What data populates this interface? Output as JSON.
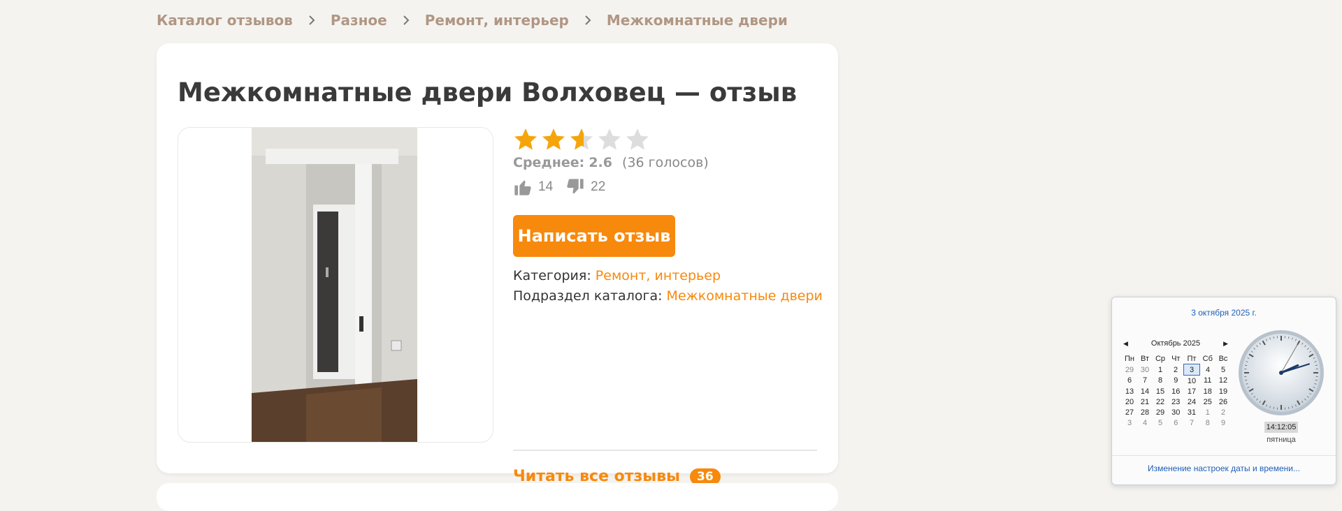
{
  "breadcrumb": [
    {
      "label": "Каталог отзывов"
    },
    {
      "label": "Разное"
    },
    {
      "label": "Ремонт, интерьер"
    },
    {
      "label": "Межкомнатные двери"
    }
  ],
  "product": {
    "title": "Межкомнатные двери Волховец — отзыв",
    "rating_value": 2.6,
    "rating_max": 5,
    "average_label": "Среднее:",
    "average_value": "2.6",
    "votes_text": "(36 голосов)",
    "likes": "14",
    "dislikes": "22",
    "write_button": "Написать отзыв",
    "category_label": "Категория:",
    "category_value": "Ремонт, интерьер",
    "subsection_label": "Подраздел каталога:",
    "subsection_value": "Межкомнатные двери",
    "read_all_label": "Читать все отзывы",
    "read_all_count": "36"
  },
  "colors": {
    "accent": "#f7890c",
    "star_filled": "#f5a50a",
    "star_empty": "#dddddd",
    "breadcrumb": "#b09684"
  },
  "calendar": {
    "date_link": "3 октября 2025 г.",
    "month_label": "Октябрь 2025",
    "weekdays": [
      "Пн",
      "Вт",
      "Ср",
      "Чт",
      "Пт",
      "Сб",
      "Вс"
    ],
    "weeks": [
      [
        "29",
        "30",
        "1",
        "2",
        "3",
        "4",
        "5"
      ],
      [
        "6",
        "7",
        "8",
        "9",
        "10",
        "11",
        "12"
      ],
      [
        "13",
        "14",
        "15",
        "16",
        "17",
        "18",
        "19"
      ],
      [
        "20",
        "21",
        "22",
        "23",
        "24",
        "25",
        "26"
      ],
      [
        "27",
        "28",
        "29",
        "30",
        "31",
        "1",
        "2"
      ],
      [
        "3",
        "4",
        "5",
        "6",
        "7",
        "8",
        "9"
      ]
    ],
    "today": "3",
    "time": "14:12:05",
    "weekday_name": "пятница",
    "settings_link": "Изменение настроек даты и времени..."
  }
}
